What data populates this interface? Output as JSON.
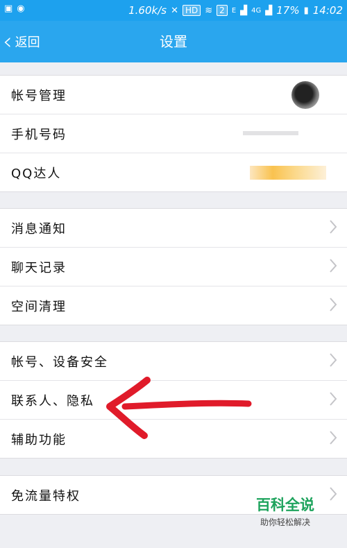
{
  "status_bar": {
    "speed": "1.60k/s",
    "hd_label": "HD",
    "sim_number": "2",
    "network_e": "E",
    "network_4g": "4G",
    "battery": "17%",
    "time": "14:02"
  },
  "header": {
    "back_label": "返回",
    "title": "设置"
  },
  "sections": [
    {
      "items": [
        {
          "label": "帐号管理"
        },
        {
          "label": "手机号码"
        },
        {
          "label": "QQ达人"
        }
      ]
    },
    {
      "items": [
        {
          "label": "消息通知"
        },
        {
          "label": "聊天记录"
        },
        {
          "label": "空间清理"
        }
      ]
    },
    {
      "items": [
        {
          "label": "帐号、设备安全"
        },
        {
          "label": "联系人、隐私"
        },
        {
          "label": "辅助功能"
        }
      ]
    },
    {
      "items": [
        {
          "label": "免流量特权"
        }
      ]
    }
  ],
  "watermark": {
    "title": "百科全说",
    "subtitle": "助你轻松解决"
  },
  "colors": {
    "header_bg": "#2aa6ee",
    "annotation_red": "#e01b2a",
    "watermark_green": "#1ea35d"
  }
}
